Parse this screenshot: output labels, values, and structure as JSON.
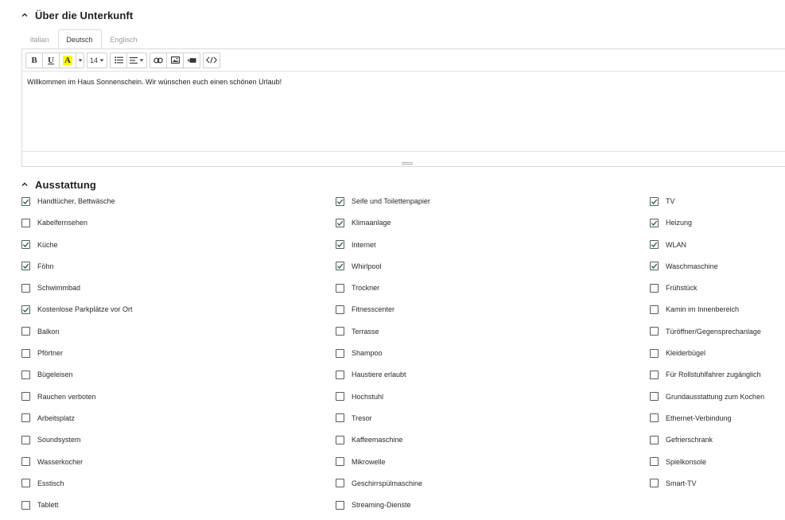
{
  "about": {
    "title": "Über die Unterkunft",
    "tabs": [
      {
        "label": "italian",
        "active": false
      },
      {
        "label": "Deutsch",
        "active": true
      },
      {
        "label": "Englisch",
        "active": false
      }
    ],
    "toolbar": {
      "bold": "B",
      "underline": "U",
      "highlight": "A",
      "font_size": "14",
      "icons": [
        "list-icon",
        "align-icon",
        "link-icon",
        "image-icon",
        "video-icon",
        "code-view-icon"
      ]
    },
    "content": "Willkommen im Haus Sonnenschein. Wir wünschen euch einen schönen Urlaub!"
  },
  "amenities": {
    "title": "Ausstattung",
    "items": [
      {
        "label": "Handtücher, Bettwäsche",
        "checked": true
      },
      {
        "label": "Seife und Toilettenpapier",
        "checked": true
      },
      {
        "label": "TV",
        "checked": true
      },
      {
        "label": "Kabelfernsehen",
        "checked": false
      },
      {
        "label": "Klimaanlage",
        "checked": true
      },
      {
        "label": "Heizung",
        "checked": true
      },
      {
        "label": "Küche",
        "checked": true
      },
      {
        "label": "Internet",
        "checked": true
      },
      {
        "label": "WLAN",
        "checked": true
      },
      {
        "label": "Föhn",
        "checked": true
      },
      {
        "label": "Whirlpool",
        "checked": true
      },
      {
        "label": "Waschmaschine",
        "checked": true
      },
      {
        "label": "Schwimmbad",
        "checked": false
      },
      {
        "label": "Trockner",
        "checked": false
      },
      {
        "label": "Frühstück",
        "checked": false
      },
      {
        "label": "Kostenlose Parkplätze vor Ort",
        "checked": true
      },
      {
        "label": "Fitnesscenter",
        "checked": false
      },
      {
        "label": "Kamin im Innenbereich",
        "checked": false
      },
      {
        "label": "Balkon",
        "checked": false
      },
      {
        "label": "Terrasse",
        "checked": false
      },
      {
        "label": "Türöffner/Gegensprechanlage",
        "checked": false
      },
      {
        "label": "Pförtner",
        "checked": false
      },
      {
        "label": "Shampoo",
        "checked": false
      },
      {
        "label": "Kleiderbügel",
        "checked": false
      },
      {
        "label": "Bügeleisen",
        "checked": false
      },
      {
        "label": "Haustiere erlaubt",
        "checked": false
      },
      {
        "label": "Für Rollstuhlfahrer zugänglich",
        "checked": false
      },
      {
        "label": "Rauchen verboten",
        "checked": false
      },
      {
        "label": "Hochstuhl",
        "checked": false
      },
      {
        "label": "Grundausstattung zum Kochen",
        "checked": false
      },
      {
        "label": "Arbeitsplatz",
        "checked": false
      },
      {
        "label": "Tresor",
        "checked": false
      },
      {
        "label": "Ethernet-Verbindung",
        "checked": false
      },
      {
        "label": "Soundsystem",
        "checked": false
      },
      {
        "label": "Kaffeemaschine",
        "checked": false
      },
      {
        "label": "Gefrierschrank",
        "checked": false
      },
      {
        "label": "Wasserkocher",
        "checked": false
      },
      {
        "label": "Mikrowelle",
        "checked": false
      },
      {
        "label": "Spielkonsole",
        "checked": false
      },
      {
        "label": "Esstisch",
        "checked": false
      },
      {
        "label": "Geschirrspülmaschine",
        "checked": false
      },
      {
        "label": "Smart-TV",
        "checked": false
      },
      {
        "label": "Tablett",
        "checked": false
      },
      {
        "label": "Streaming-Dienste",
        "checked": false
      }
    ]
  },
  "colors": {
    "checkbox_border": "#5a5a5a",
    "check_mark": "#1a5c56",
    "highlight": "#ffff00"
  }
}
